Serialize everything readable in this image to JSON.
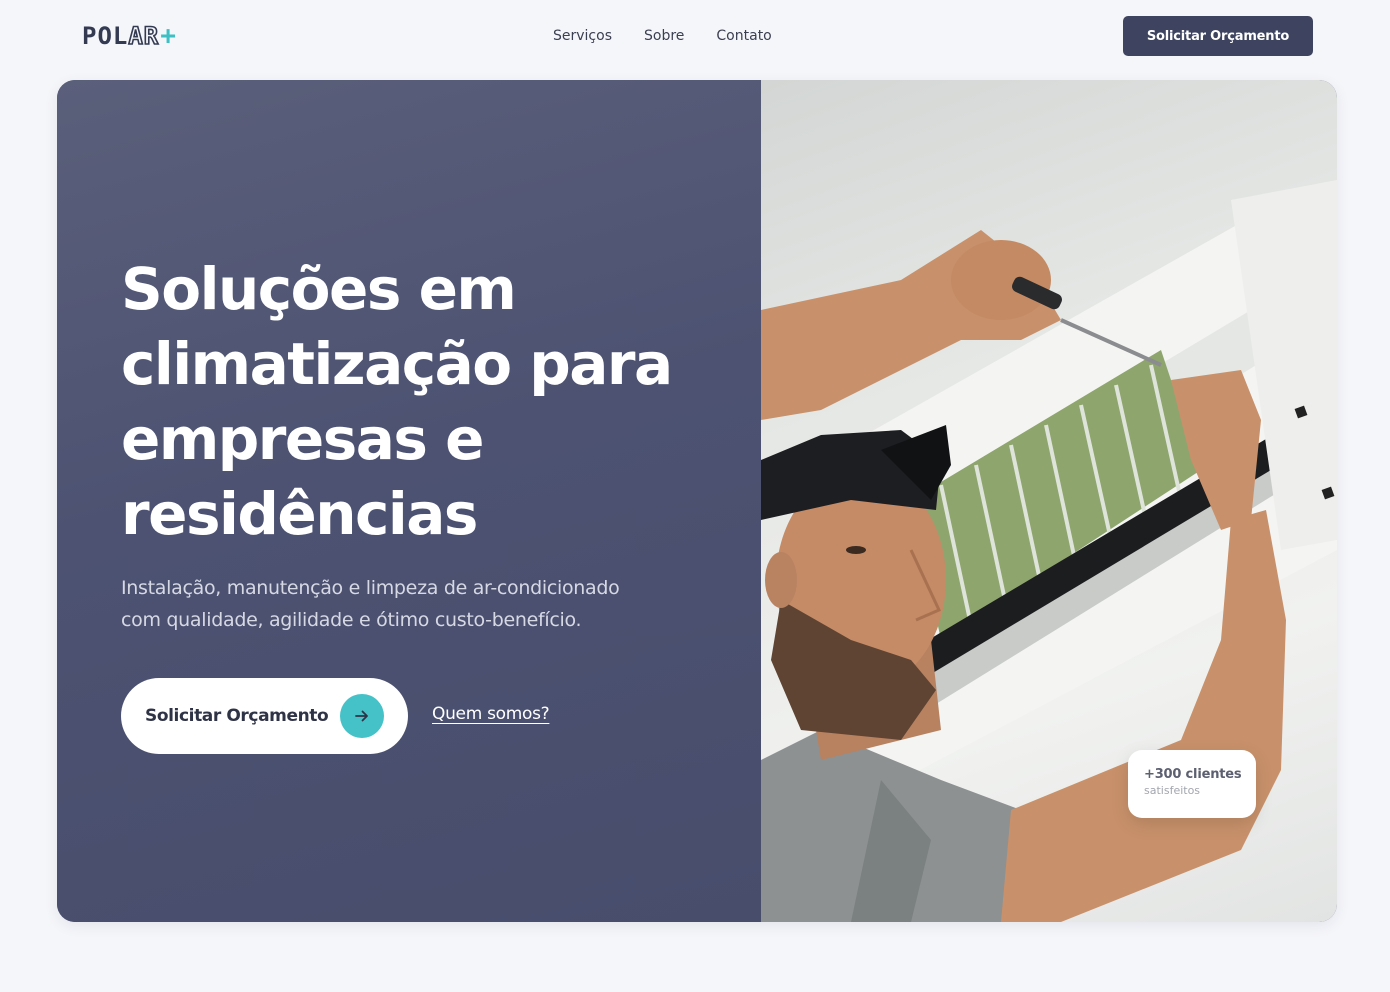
{
  "header": {
    "logo": {
      "part1": "POL",
      "part2": "AR",
      "plus": "+"
    },
    "nav": [
      {
        "label": "Serviços"
      },
      {
        "label": "Sobre"
      },
      {
        "label": "Contato"
      }
    ],
    "cta_label": "Solicitar Orçamento"
  },
  "hero": {
    "title_lines": [
      "Soluções em",
      "climatização para",
      "empresas e",
      "residências"
    ],
    "subtitle_lines": [
      "Instalação, manutenção e limpeza de ar-condicionado",
      "com qualidade, agilidade e ótimo custo-benefício."
    ],
    "primary_cta": {
      "label": "Solicitar Orçamento",
      "icon": "arrow-right-icon"
    },
    "secondary_link": "Quem somos?",
    "badge": {
      "value": "+300 clientes",
      "label": "satisfeitos"
    }
  },
  "colors": {
    "page_bg": "#f5f6fa",
    "hero_bg": "#4d5272",
    "primary_dark": "#3e4460",
    "accent_teal": "#45c1c8",
    "text_dark": "#2f3346"
  }
}
